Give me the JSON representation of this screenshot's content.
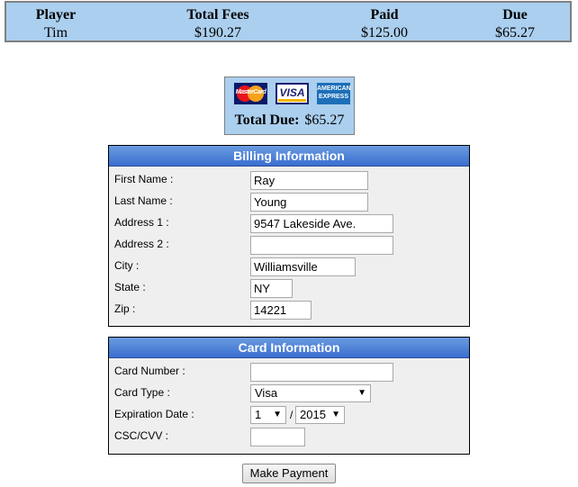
{
  "summary": {
    "headers": [
      "Player",
      "Total Fees",
      "Paid",
      "Due"
    ],
    "values": [
      "Tim",
      "$190.27",
      "$125.00",
      "$65.27"
    ]
  },
  "payment_box": {
    "logos": [
      {
        "name": "mastercard-logo",
        "text": "MasterCard"
      },
      {
        "name": "visa-logo",
        "text": "VISA"
      },
      {
        "name": "amex-logo",
        "text": "AMERICAN EXPRESS"
      }
    ],
    "total_due_label": "Total Due:",
    "total_due_value": "$65.27"
  },
  "billing": {
    "title": "Billing Information",
    "fields": [
      {
        "label": "First Name :",
        "value": ""
      },
      {
        "label": "Last Name :",
        "value": ""
      },
      {
        "label": "Address 1 :",
        "value": ""
      },
      {
        "label": "Address 2 :",
        "value": ""
      },
      {
        "label": "City :",
        "value": ""
      },
      {
        "label": "State :",
        "value": ""
      },
      {
        "label": "Zip :",
        "value": ""
      }
    ],
    "values": {
      "first_name": "Ray",
      "last_name": "Young",
      "address1": "9547 Lakeside Ave.",
      "address2": "",
      "city": "Williamsville",
      "state": "NY",
      "zip": "14221"
    }
  },
  "card": {
    "title": "Card Information",
    "labels": {
      "card_number": "Card Number :",
      "card_type": "Card Type :",
      "expiration": "Expiration Date :",
      "csc": "CSC/CVV :"
    },
    "card_number": "",
    "card_type": "Visa",
    "exp_month": "1",
    "exp_separator": "/",
    "exp_year": "2015",
    "csc": "",
    "dropdown_arrow": "▼"
  },
  "submit_label": "Make Payment"
}
